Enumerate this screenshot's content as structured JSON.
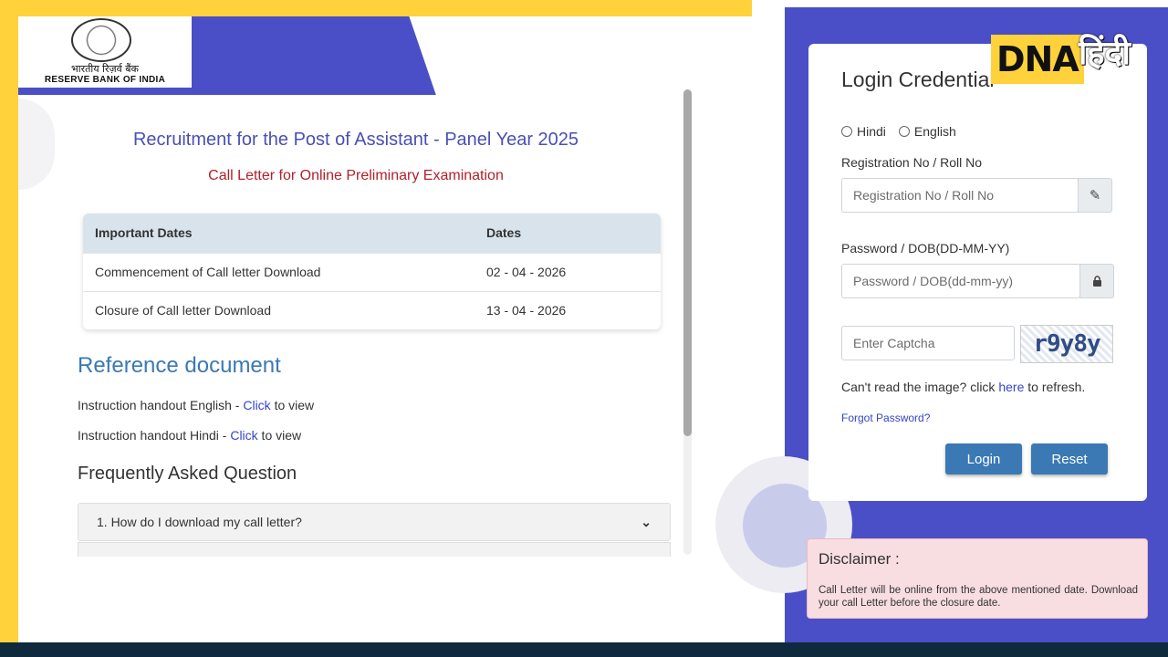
{
  "bank": {
    "name_hindi": "भारतीय रिज़र्व बैंक",
    "name_english": "RESERVE BANK OF INDIA"
  },
  "watermark": {
    "brand": "DNA",
    "hindi": "हिंदी"
  },
  "main": {
    "title": "Recruitment for the Post of Assistant - Panel Year 2025",
    "subtitle": "Call Letter for Online Preliminary Examination",
    "table": {
      "headers": [
        "Important Dates",
        "Dates"
      ],
      "rows": [
        [
          "Commencement of Call letter Download",
          "02 - 04 - 2026"
        ],
        [
          "Closure of Call letter Download",
          "13 - 04 - 2026"
        ]
      ]
    },
    "reference": {
      "heading": "Reference document",
      "items": [
        {
          "prefix": "Instruction handout English - ",
          "link": "Click",
          "suffix": " to view"
        },
        {
          "prefix": "Instruction handout Hindi - ",
          "link": "Click",
          "suffix": " to view"
        }
      ]
    },
    "faq": {
      "heading": "Frequently Asked Question",
      "items": [
        "1. How do I download my call letter?"
      ]
    }
  },
  "login": {
    "title": "Login Credential",
    "languages": [
      "Hindi",
      "English"
    ],
    "registration": {
      "label": "Registration No / Roll No",
      "placeholder": "Registration No / Roll No",
      "icon": "pencil-icon"
    },
    "password": {
      "label": "Password / DOB(DD-MM-YY)",
      "placeholder": "Password / DOB(dd-mm-yy)",
      "icon": "lock-icon"
    },
    "captcha": {
      "placeholder": "Enter Captcha",
      "text": "r9y8y"
    },
    "refresh": {
      "prefix": "Can't read the image? click ",
      "link": "here",
      "suffix": " to refresh."
    },
    "forgot": "Forgot Password?",
    "login_button": "Login",
    "reset_button": "Reset"
  },
  "disclaimer": {
    "title": "Disclaimer :",
    "body": "Call Letter will be online from the above mentioned date. Download your call Letter before the closure date."
  },
  "colors": {
    "brand_indigo": "#4a4fc7",
    "frame_yellow": "#ffd23c",
    "button_blue": "#3a79b4",
    "title_blue": "#4a4fb5",
    "subtitle_red": "#b3202a"
  }
}
